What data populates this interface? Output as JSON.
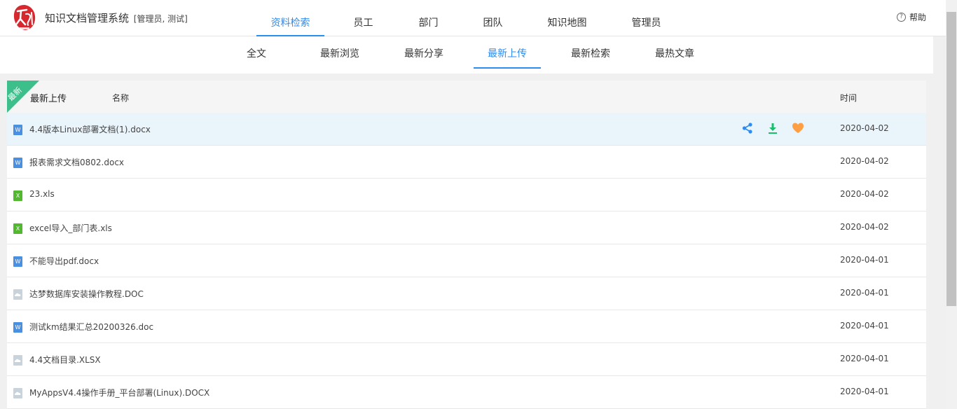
{
  "header": {
    "logo_text": "天湖",
    "title": "知识文档管理系统",
    "role": "[管理员, 测试]",
    "nav": [
      {
        "label": "资料检索",
        "active": true
      },
      {
        "label": "员工",
        "active": false
      },
      {
        "label": "部门",
        "active": false
      },
      {
        "label": "团队",
        "active": false
      },
      {
        "label": "知识地图",
        "active": false
      },
      {
        "label": "管理员",
        "active": false
      }
    ],
    "help_label": "帮助"
  },
  "subnav": [
    {
      "label": "全文",
      "active": false
    },
    {
      "label": "最新浏览",
      "active": false
    },
    {
      "label": "最新分享",
      "active": false
    },
    {
      "label": "最新上传",
      "active": true
    },
    {
      "label": "最新检索",
      "active": false
    },
    {
      "label": "最热文章",
      "active": false
    }
  ],
  "panel": {
    "ribbon": "最新",
    "title": "最新上传",
    "col_name": "名称",
    "col_time": "时间",
    "rows": [
      {
        "name": "4.4版本Linux部署文档(1).docx",
        "time": "2020-04-02",
        "type": "word",
        "icon_letter": "W",
        "hover": true
      },
      {
        "name": "报表需求文档0802.docx",
        "time": "2020-04-02",
        "type": "word",
        "icon_letter": "W"
      },
      {
        "name": "23.xls",
        "time": "2020-04-02",
        "type": "excel",
        "icon_letter": "X"
      },
      {
        "name": "excel导入_部门表.xls",
        "time": "2020-04-02",
        "type": "excel",
        "icon_letter": "X"
      },
      {
        "name": "不能导出pdf.docx",
        "time": "2020-04-01",
        "type": "word",
        "icon_letter": "W"
      },
      {
        "name": "达梦数据库安装操作教程.DOC",
        "time": "2020-04-01",
        "type": "other",
        "icon_letter": ""
      },
      {
        "name": "测试km结果汇总20200326.doc",
        "time": "2020-04-01",
        "type": "word",
        "icon_letter": "W"
      },
      {
        "name": "4.4文档目录.XLSX",
        "time": "2020-04-01",
        "type": "other",
        "icon_letter": ""
      },
      {
        "name": "MyAppsV4.4操作手册_平台部署(Linux).DOCX",
        "time": "2020-04-01",
        "type": "other",
        "icon_letter": ""
      }
    ]
  },
  "colors": {
    "accent": "#2d8cf0",
    "ribbon": "#3cbf8a",
    "share": "#2d8cf0",
    "download": "#19be6b",
    "favorite": "#ff9f43"
  }
}
